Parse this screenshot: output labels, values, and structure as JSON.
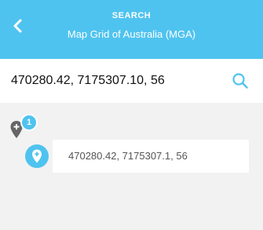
{
  "header": {
    "title": "SEARCH",
    "subtitle": "Map Grid of Australia (MGA)",
    "back_icon": "chevron-left-icon"
  },
  "search": {
    "value": "470280.42, 7175307.10, 56",
    "icon": "search-icon"
  },
  "markers": {
    "count": "1",
    "icon": "add-location-icon"
  },
  "results": [
    {
      "text": "470280.42, 7175307.1, 56",
      "icon": "location-pin-icon"
    }
  ],
  "colors": {
    "accent": "#4fc3ef",
    "background": "#f2f2f2",
    "marker_gray": "#666666"
  }
}
